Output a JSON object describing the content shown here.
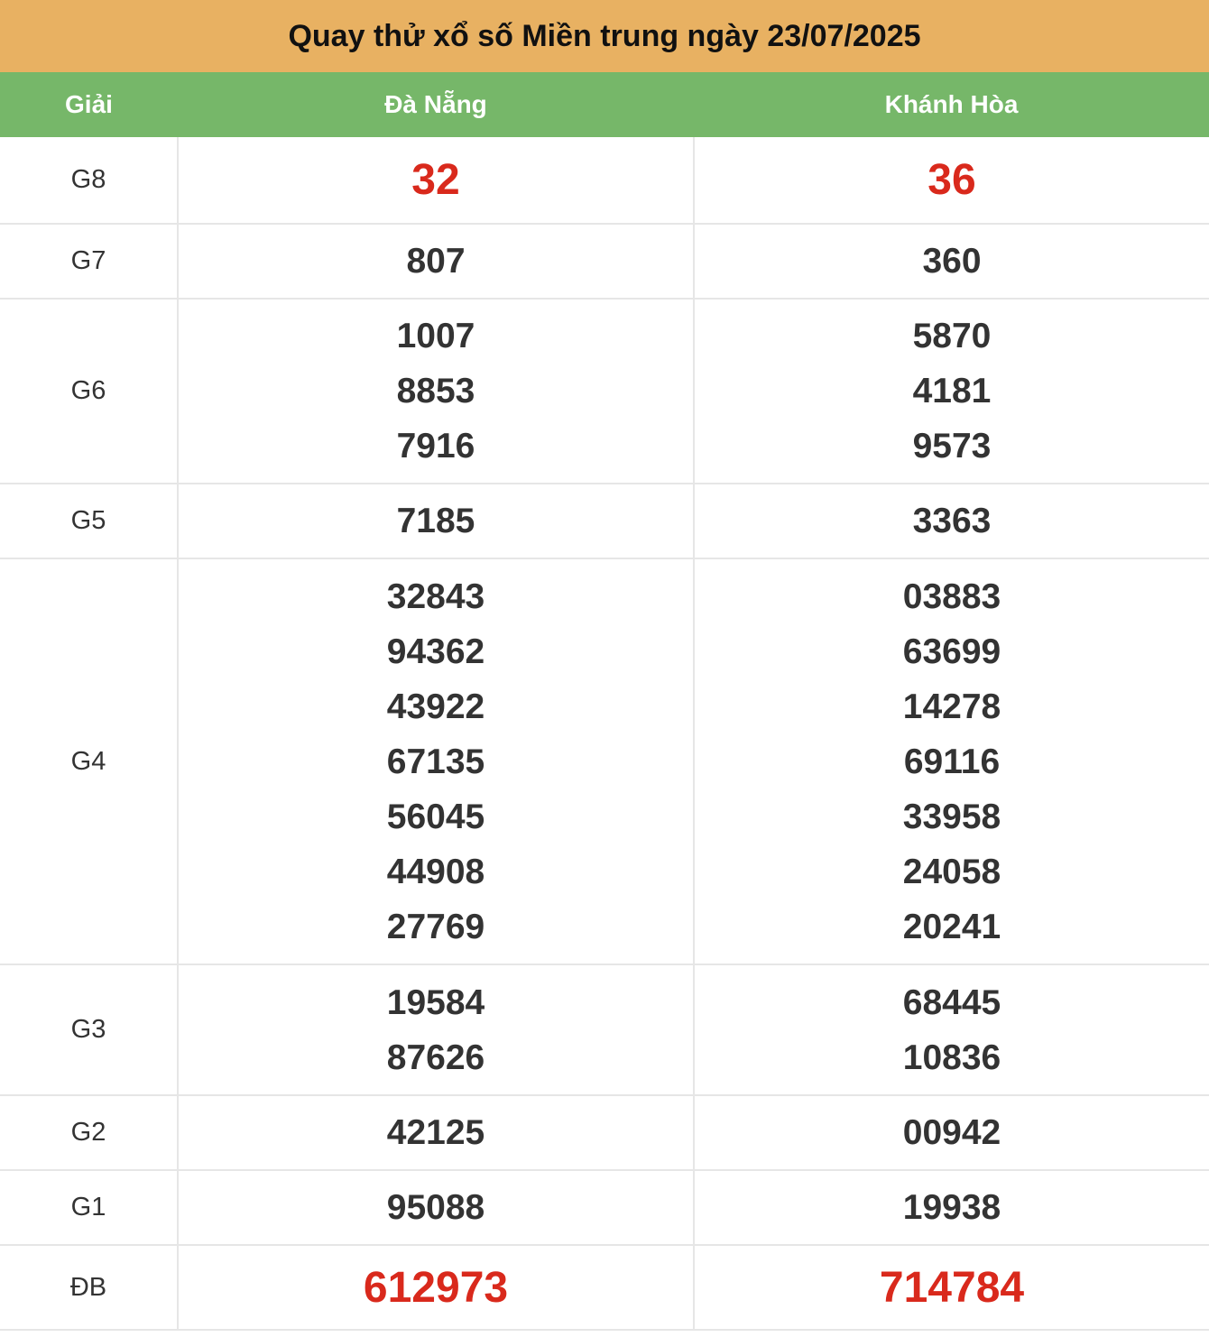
{
  "title": "Quay thử xổ số Miền trung ngày 23/07/2025",
  "header": {
    "prize_col": "Giải",
    "province_1": "Đà Nẵng",
    "province_2": "Khánh Hòa"
  },
  "colors": {
    "title_bg": "#E8B162",
    "header_bg": "#76B769",
    "highlight_red": "#D9291C",
    "text_dark": "#333333"
  },
  "rows": [
    {
      "prize": "G8",
      "province_1": [
        "32"
      ],
      "province_2": [
        "36"
      ]
    },
    {
      "prize": "G7",
      "province_1": [
        "807"
      ],
      "province_2": [
        "360"
      ]
    },
    {
      "prize": "G6",
      "province_1": [
        "1007",
        "8853",
        "7916"
      ],
      "province_2": [
        "5870",
        "4181",
        "9573"
      ]
    },
    {
      "prize": "G5",
      "province_1": [
        "7185"
      ],
      "province_2": [
        "3363"
      ]
    },
    {
      "prize": "G4",
      "province_1": [
        "32843",
        "94362",
        "43922",
        "67135",
        "56045",
        "44908",
        "27769"
      ],
      "province_2": [
        "03883",
        "63699",
        "14278",
        "69116",
        "33958",
        "24058",
        "20241"
      ]
    },
    {
      "prize": "G3",
      "province_1": [
        "19584",
        "87626"
      ],
      "province_2": [
        "68445",
        "10836"
      ]
    },
    {
      "prize": "G2",
      "province_1": [
        "42125"
      ],
      "province_2": [
        "00942"
      ]
    },
    {
      "prize": "G1",
      "province_1": [
        "95088"
      ],
      "province_2": [
        "19938"
      ]
    },
    {
      "prize": "ĐB",
      "province_1": [
        "612973"
      ],
      "province_2": [
        "714784"
      ]
    }
  ]
}
